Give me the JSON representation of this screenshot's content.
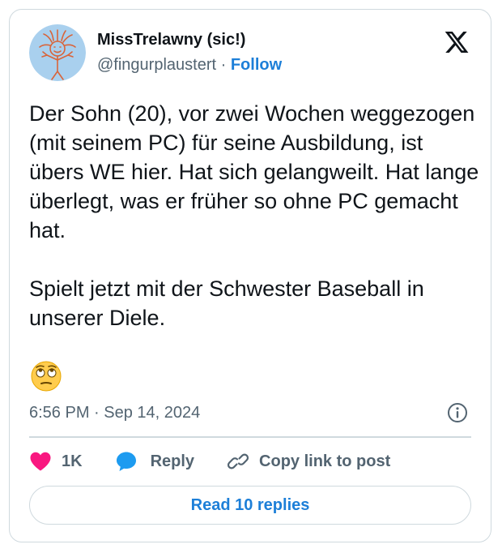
{
  "author": {
    "display_name": "MissTrelawny (sic!)",
    "handle": "@fingurplaustert",
    "separator": " · ",
    "follow_label": "Follow",
    "avatar_icon": "stick-figure-avatar-icon"
  },
  "platform": {
    "logo_icon": "x-logo-icon"
  },
  "tweet": {
    "paragraphs": [
      "Der Sohn (20), vor zwei Wochen weggezogen (mit seinem PC) für seine Ausbildung, ist übers WE hier. Hat sich gelangweilt. Hat lange überlegt, was er früher so ohne PC gemacht hat.",
      "Spielt jetzt mit der Schwester Baseball in unserer Diele."
    ],
    "emoji": "face-with-rolling-eyes",
    "timestamp": "6:56 PM · Sep 14, 2024"
  },
  "actions": {
    "like_count": "1K",
    "reply_label": "Reply",
    "copy_link_label": "Copy link to post"
  },
  "footer": {
    "read_replies_label": "Read 10 replies"
  },
  "colors": {
    "text": "#0f1419",
    "secondary_text": "#536471",
    "link_blue": "#1d7fd8",
    "like_pink": "#f91880",
    "reply_blue": "#1d9bf0",
    "border": "#cfd9de"
  }
}
